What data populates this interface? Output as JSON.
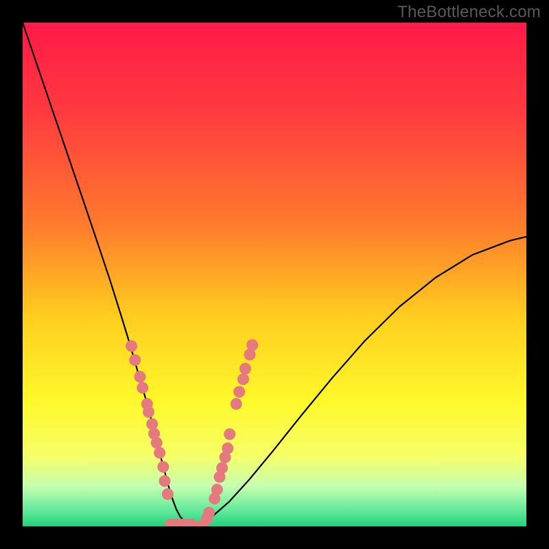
{
  "watermark": "TheBottleneck.com",
  "chart_data": {
    "type": "line",
    "title": "",
    "xlabel": "",
    "ylabel": "",
    "xlim": [
      0,
      100
    ],
    "ylim": [
      0,
      100
    ],
    "gradient_stops": [
      {
        "offset": 0,
        "color": "#ff1a47"
      },
      {
        "offset": 18,
        "color": "#ff3b3f"
      },
      {
        "offset": 40,
        "color": "#ff7a2d"
      },
      {
        "offset": 58,
        "color": "#ffcc1f"
      },
      {
        "offset": 75,
        "color": "#fff82a"
      },
      {
        "offset": 86,
        "color": "#f6ff66"
      },
      {
        "offset": 92,
        "color": "#c6ffb0"
      },
      {
        "offset": 97,
        "color": "#5fe89a"
      },
      {
        "offset": 100,
        "color": "#22d27b"
      }
    ],
    "series": [
      {
        "name": "bottleneck-curve",
        "x": [
          0,
          3,
          6,
          9,
          12,
          15,
          17.4,
          19.5,
          21.4,
          23,
          24.5,
          25.7,
          26.7,
          27.6,
          28.4,
          29.1,
          29.8,
          30.5,
          31.3,
          32.3,
          33.6,
          35.4,
          37.8,
          41,
          45,
          49.8,
          55.3,
          61.4,
          67.9,
          74.8,
          82,
          89.3,
          96.7,
          100
        ],
        "y": [
          100,
          91.2,
          82.4,
          73.6,
          64.8,
          55.9,
          48.7,
          42,
          35.8,
          30.2,
          25.1,
          20.6,
          16.6,
          13.1,
          10.1,
          7.5,
          5.3,
          3.4,
          1.9,
          0.8,
          0.2,
          0.6,
          2.1,
          4.9,
          9.3,
          15.1,
          22,
          29.4,
          36.8,
          43.6,
          49.4,
          53.9,
          56.7,
          57.5
        ]
      }
    ],
    "markers": {
      "name": "sample-dots",
      "color": "#e47a7e",
      "points": [
        {
          "x": 21.6,
          "y": 35.8
        },
        {
          "x": 22.3,
          "y": 33.0
        },
        {
          "x": 23.3,
          "y": 29.7
        },
        {
          "x": 23.8,
          "y": 27.5
        },
        {
          "x": 24.7,
          "y": 24.3
        },
        {
          "x": 25.0,
          "y": 22.7
        },
        {
          "x": 25.7,
          "y": 20.3
        },
        {
          "x": 26.1,
          "y": 18.4
        },
        {
          "x": 26.6,
          "y": 16.6
        },
        {
          "x": 27.2,
          "y": 14.6
        },
        {
          "x": 27.9,
          "y": 11.8
        },
        {
          "x": 28.2,
          "y": 9.0
        },
        {
          "x": 28.8,
          "y": 6.4
        },
        {
          "x": 35.2,
          "y": 0.0
        },
        {
          "x": 35.7,
          "y": 0.0
        },
        {
          "x": 36.6,
          "y": 1.5
        },
        {
          "x": 37.0,
          "y": 2.7
        },
        {
          "x": 38.1,
          "y": 5.5
        },
        {
          "x": 38.6,
          "y": 7.3
        },
        {
          "x": 39.1,
          "y": 9.8
        },
        {
          "x": 39.6,
          "y": 11.6
        },
        {
          "x": 40.2,
          "y": 13.7
        },
        {
          "x": 40.7,
          "y": 15.5
        },
        {
          "x": 41.1,
          "y": 18.3
        },
        {
          "x": 42.4,
          "y": 24.3
        },
        {
          "x": 43.0,
          "y": 26.7
        },
        {
          "x": 43.8,
          "y": 29.2
        },
        {
          "x": 44.2,
          "y": 31.3
        },
        {
          "x": 45.1,
          "y": 34.1
        },
        {
          "x": 45.6,
          "y": 36.0
        }
      ]
    },
    "bottom_cap": {
      "x0": 29.3,
      "x1": 33.5,
      "y": 0.4
    }
  }
}
